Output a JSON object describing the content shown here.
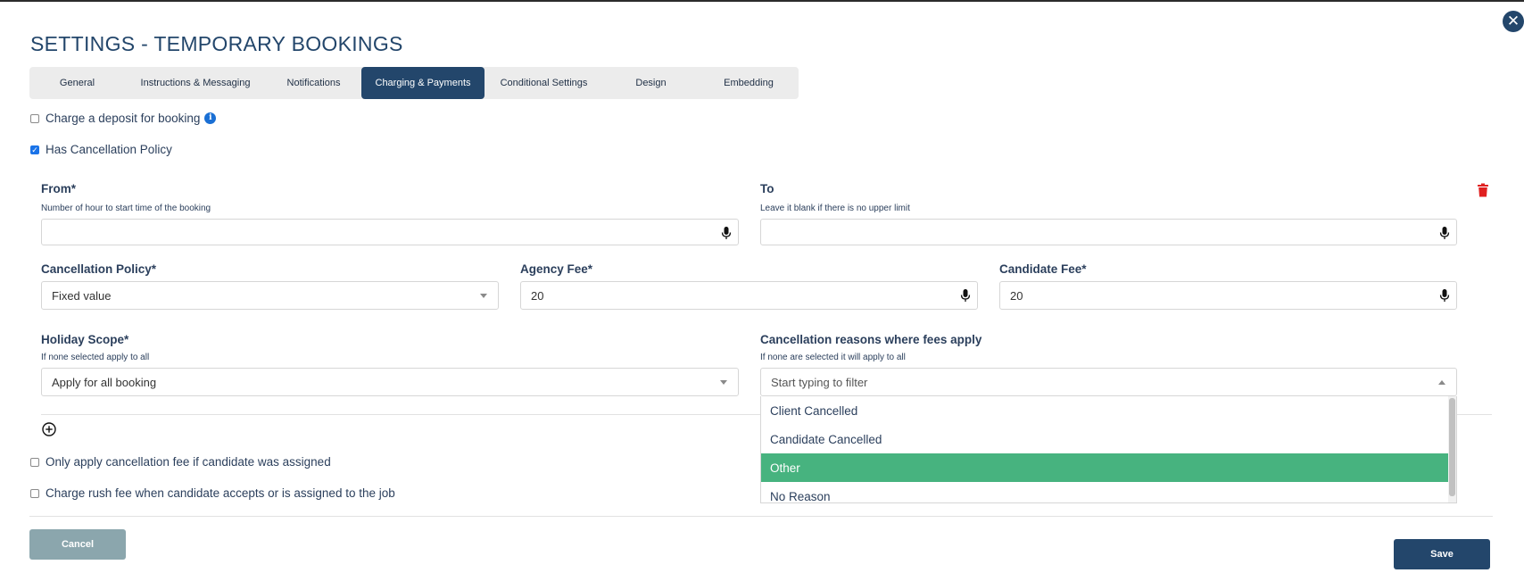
{
  "page_title": "SETTINGS - TEMPORARY BOOKINGS",
  "tabs": [
    {
      "label": "General"
    },
    {
      "label": "Instructions & Messaging"
    },
    {
      "label": "Notifications"
    },
    {
      "label": "Charging & Payments",
      "active": true
    },
    {
      "label": "Conditional Settings"
    },
    {
      "label": "Design"
    },
    {
      "label": "Embedding"
    }
  ],
  "deposit": {
    "label": "Charge a deposit for booking",
    "checked": false
  },
  "cancellation_policy_toggle": {
    "label": "Has Cancellation Policy",
    "checked": true
  },
  "policy": {
    "from": {
      "label": "From*",
      "hint": "Number of hour to start time of the booking",
      "value": ""
    },
    "to": {
      "label": "To",
      "hint": "Leave it blank if there is no upper limit",
      "value": ""
    },
    "cancellation_policy": {
      "label": "Cancellation Policy*",
      "value": "Fixed value"
    },
    "agency_fee": {
      "label": "Agency Fee*",
      "value": "20"
    },
    "candidate_fee": {
      "label": "Candidate Fee*",
      "value": "20"
    },
    "holiday_scope": {
      "label": "Holiday Scope*",
      "hint": "If none selected apply to all",
      "value": "Apply for all booking"
    },
    "cancellation_reasons": {
      "label": "Cancellation reasons where fees apply",
      "hint": "If none are selected it will apply to all",
      "placeholder": "Start typing to filter",
      "options": [
        "Client Cancelled",
        "Candidate Cancelled",
        "Other",
        "No Reason"
      ],
      "highlighted": "Other"
    }
  },
  "only_apply_assigned": {
    "label": "Only apply cancellation fee if candidate was assigned",
    "checked": false
  },
  "rush_fee": {
    "label": "Charge rush fee when candidate accepts or is assigned to the job",
    "checked": false
  },
  "buttons": {
    "cancel": "Cancel",
    "save": "Save"
  },
  "icons": {
    "close": "close-icon",
    "info": "info-icon",
    "mic": "microphone-icon",
    "trash": "trash-icon",
    "add": "add-circle-icon"
  },
  "colors": {
    "primary": "#23466b",
    "success": "#47b37f",
    "danger": "#e02020",
    "cancel_button": "#8ba6ad"
  }
}
